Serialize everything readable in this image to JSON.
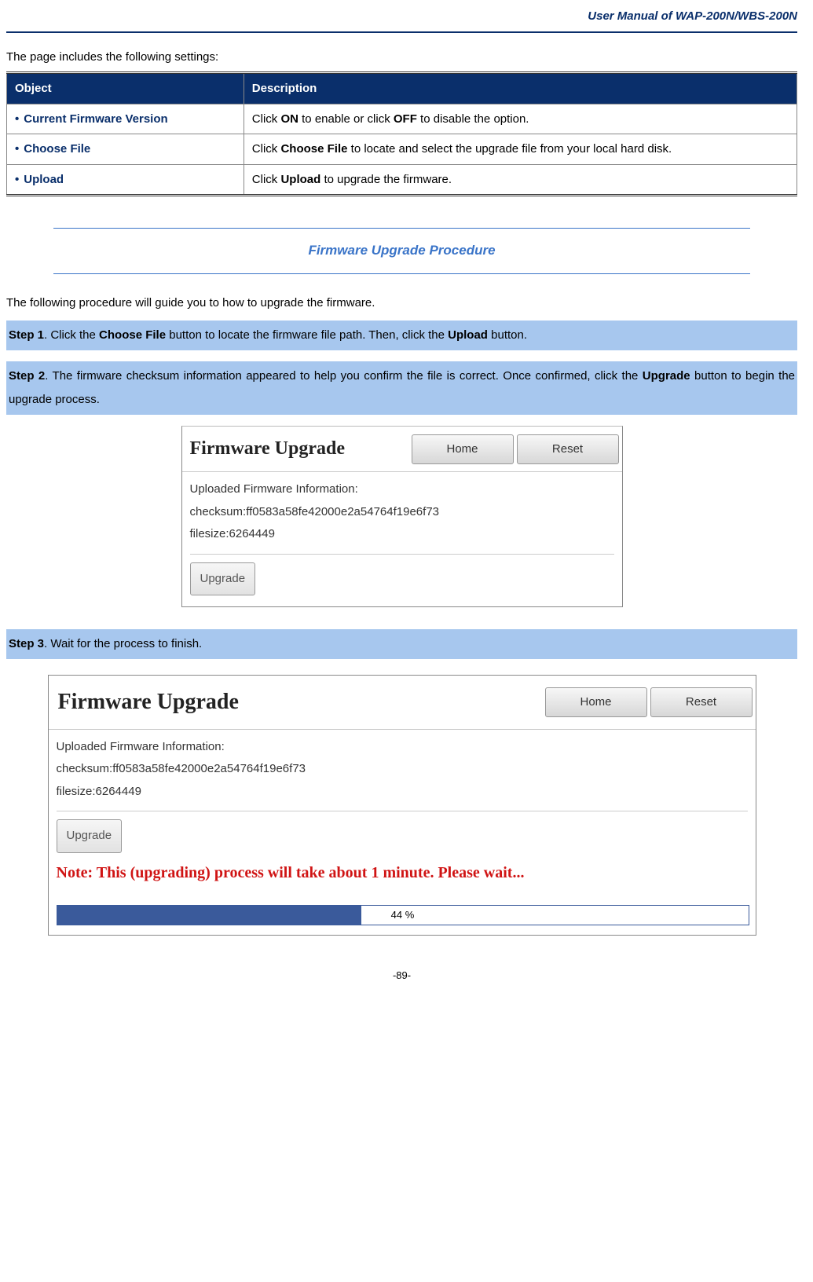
{
  "header": {
    "title": "User Manual of WAP-200N/WBS-200N"
  },
  "intro": "The page includes the following settings:",
  "table": {
    "headers": {
      "object": "Object",
      "description": "Description"
    },
    "rows": [
      {
        "object": "Current Firmware Version",
        "desc_pre": "Click ",
        "desc_b1": "ON",
        "desc_mid": " to enable or click ",
        "desc_b2": "OFF",
        "desc_post": " to disable the option."
      },
      {
        "object": "Choose File",
        "desc_pre": "Click ",
        "desc_b1": "Choose File",
        "desc_mid": " to locate and select the upgrade file from your local hard disk.",
        "desc_b2": "",
        "desc_post": ""
      },
      {
        "object": "Upload",
        "desc_pre": "Click ",
        "desc_b1": "Upload",
        "desc_mid": " to upgrade the firmware.",
        "desc_b2": "",
        "desc_post": ""
      }
    ]
  },
  "section_heading": "Firmware Upgrade Procedure",
  "procedure_intro": "The following procedure will guide you to how to upgrade the firmware.",
  "steps": {
    "s1": {
      "label": "Step 1",
      "t1": ". Click the ",
      "b1": "Choose File",
      "t2": " button to locate the firmware file path. Then, click the ",
      "b2": "Upload",
      "t3": " button."
    },
    "s2": {
      "label": "Step 2",
      "t1": ". The firmware checksum information appeared to help you confirm the file is correct. Once confirmed, click the ",
      "b1": "Upgrade",
      "t2": " button to begin the upgrade process."
    },
    "s3": {
      "label": "Step 3",
      "t1": ". Wait for the process to finish."
    }
  },
  "screenshot1": {
    "title": "Firmware Upgrade",
    "home": "Home",
    "reset": "Reset",
    "info_title": "Uploaded Firmware Information:",
    "checksum": "checksum:ff0583a58fe42000e2a54764f19e6f73",
    "filesize": "filesize:6264449",
    "upgrade": "Upgrade"
  },
  "screenshot2": {
    "title": "Firmware Upgrade",
    "home": "Home",
    "reset": "Reset",
    "info_title": "Uploaded Firmware Information:",
    "checksum": "checksum:ff0583a58fe42000e2a54764f19e6f73",
    "filesize": "filesize:6264449",
    "upgrade": "Upgrade",
    "note": "Note: This (upgrading) process will take about 1 minute. Please wait...",
    "progress_percent": "44 %",
    "progress_value": 44
  },
  "page_number": "-89-"
}
